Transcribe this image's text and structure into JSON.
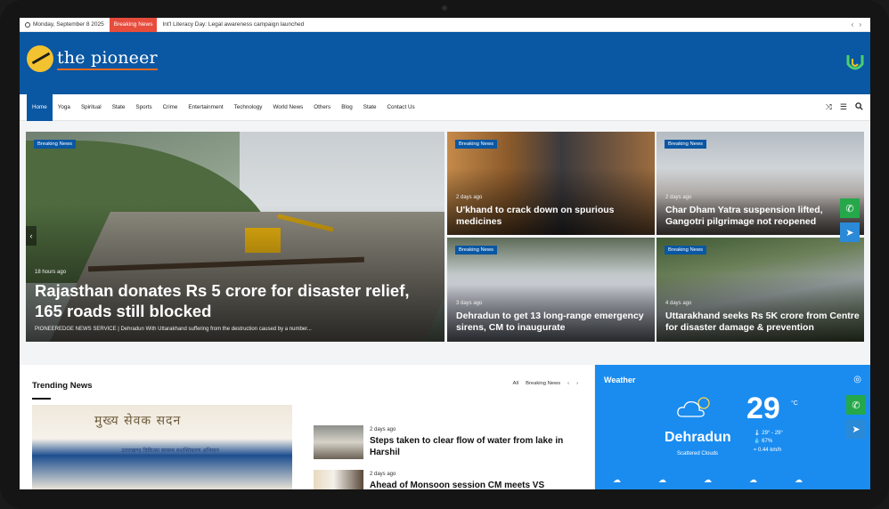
{
  "topbar": {
    "date": "Monday, September 8 2025",
    "breaking_label": "Breaking News",
    "breaking_text": "Int'l Literacy Day: Legal awareness campaign launched",
    "prev": "‹",
    "next": "›"
  },
  "header": {
    "logo_text": "the pioneer"
  },
  "nav": {
    "items": [
      "Home",
      "Yoga",
      "Spiritual",
      "State",
      "Sports",
      "Crime",
      "Entertainment",
      "Technology",
      "World News",
      "Others",
      "Blog",
      "State",
      "Contact Us"
    ],
    "icons": [
      "shuffle-icon",
      "menu-icon",
      "search-icon"
    ]
  },
  "hero": {
    "main": {
      "badge": "Breaking News",
      "time": "18 hours ago",
      "title": "Rajasthan donates Rs 5 crore for disaster relief, 165 roads still blocked",
      "excerpt": "PIONEEREDGE NEWS SERVICE | Dehradun With Uttarakhand suffering from the destruction caused by a number..."
    },
    "tiles": [
      {
        "badge": "Breaking News",
        "time": "2 days ago",
        "title": "U'khand to crack down on spurious medicines"
      },
      {
        "badge": "Breaking News",
        "time": "2 days ago",
        "title": "Char Dham Yatra suspension lifted, Gangotri pilgrimage not reopened"
      },
      {
        "badge": "Breaking News",
        "time": "3 days ago",
        "title": "Dehradun to get 13 long-range emergency sirens, CM to inaugurate"
      },
      {
        "badge": "Breaking News",
        "time": "4 days ago",
        "title": "Uttarakhand seeks Rs 5K crore from Centre for disaster damage & prevention"
      }
    ]
  },
  "trending": {
    "title": "Trending News",
    "tab_all": "All",
    "tab_breaking": "Breaking News",
    "prev": "‹",
    "next": "›",
    "hindi_sign": "मुख्य सेवक सदन",
    "banner": "उत्तराखण्ड चिकित्सा स्वास्थ्य सशक्तिकरण अभियान",
    "items": [
      {
        "time": "2 days ago",
        "title": "Steps taken to clear flow of water from lake in Harshil"
      },
      {
        "time": "2 days ago",
        "title": "Ahead of Monsoon session CM meets VS speaker"
      }
    ]
  },
  "weather": {
    "title": "Weather",
    "temp": "29",
    "unit": "°C",
    "city": "Dehradun",
    "desc": "Scattered Clouds",
    "range": "29° - 29°",
    "humidity": "67%",
    "wind": "0.44 km/h"
  },
  "colors": {
    "brand": "#0a57a3",
    "breaking": "#e74c3c",
    "weather": "#1a8cf0",
    "whatsapp": "#25a84a",
    "telegram": "#2a8ad8"
  }
}
